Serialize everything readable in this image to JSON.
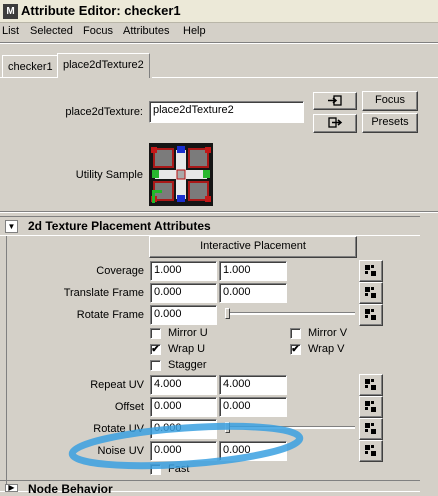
{
  "window": {
    "title": "Attribute Editor: checker1",
    "icon_letter": "M"
  },
  "menu": [
    "List",
    "Selected",
    "Focus",
    "Attributes",
    "Help"
  ],
  "tabs": [
    {
      "label": "checker1",
      "active": false
    },
    {
      "label": "place2dTexture2",
      "active": true
    }
  ],
  "node": {
    "type_label": "place2dTexture:",
    "name_value": "place2dTexture2",
    "focus_label": "Focus",
    "presets_label": "Presets",
    "utility_sample_label": "Utility Sample"
  },
  "section_2d": {
    "title": "2d Texture Placement Attributes",
    "interactive_placement_label": "Interactive Placement",
    "coverage": {
      "label": "Coverage",
      "u": "1.000",
      "v": "1.000"
    },
    "translate_frame": {
      "label": "Translate Frame",
      "u": "0.000",
      "v": "0.000"
    },
    "rotate_frame": {
      "label": "Rotate Frame",
      "value": "0.000",
      "slider_fraction": 0.0
    },
    "mirror_u": {
      "label": "Mirror U",
      "checked": false
    },
    "mirror_v": {
      "label": "Mirror V",
      "checked": false
    },
    "wrap_u": {
      "label": "Wrap U",
      "checked": true
    },
    "wrap_v": {
      "label": "Wrap V",
      "checked": true
    },
    "stagger": {
      "label": "Stagger",
      "checked": false
    },
    "repeat_uv": {
      "label": "Repeat UV",
      "u": "4.000",
      "v": "4.000"
    },
    "offset": {
      "label": "Offset",
      "u": "0.000",
      "v": "0.000"
    },
    "rotate_uv": {
      "label": "Rotate UV",
      "value": "0.000",
      "slider_fraction": 0.0
    },
    "noise_uv": {
      "label": "Noise UV",
      "u": "0.000",
      "v": "0.000"
    },
    "fast": {
      "label": "Fast",
      "checked": false
    }
  },
  "section_node": {
    "title": "Node Behavior"
  },
  "check_mark": "✔",
  "colors": {
    "highlight_ellipse": "#3aa0e0",
    "window_bg": "#d4d0c8"
  }
}
